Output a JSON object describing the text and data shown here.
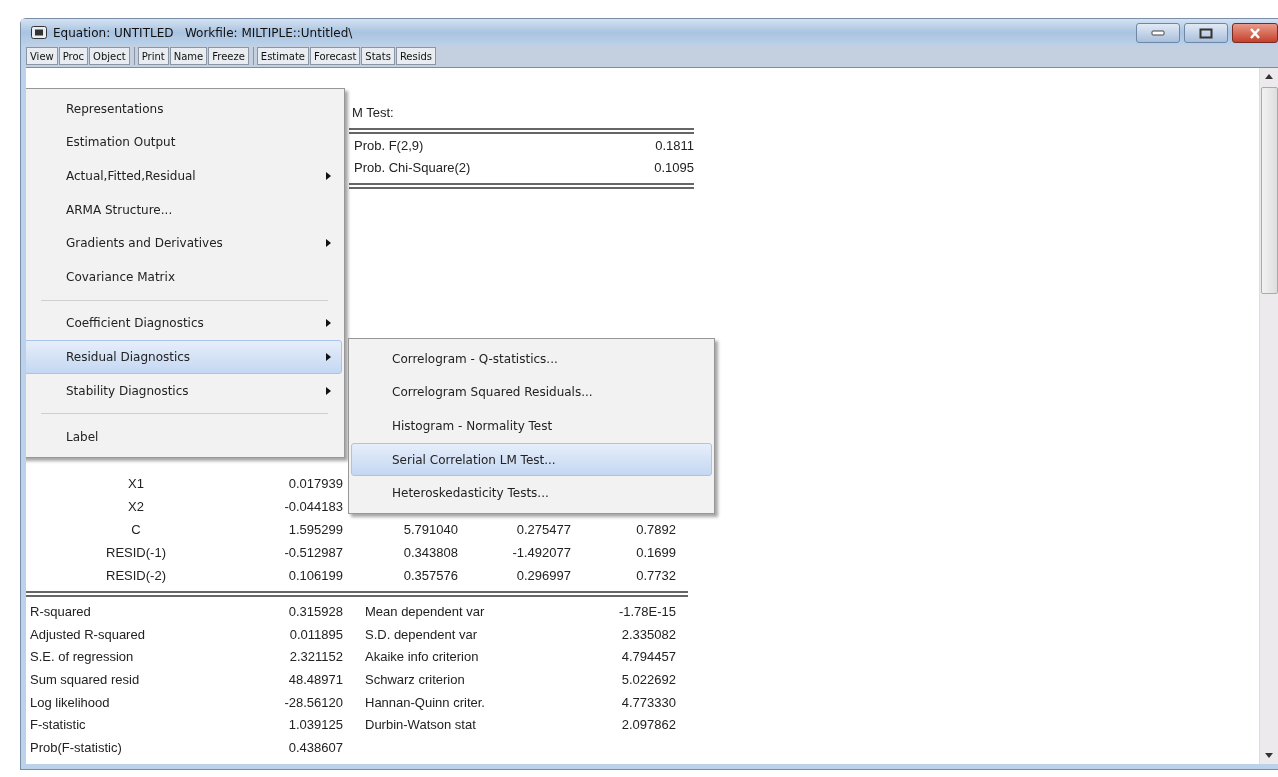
{
  "window": {
    "title": "Equation: UNTITLED   Workfile: MILTIPLE::Untitled\\"
  },
  "toolbar_groups": [
    {
      "buttons": [
        "View",
        "Proc",
        "Object"
      ]
    },
    {
      "buttons": [
        "Print",
        "Name",
        "Freeze"
      ]
    },
    {
      "buttons": [
        "Estimate",
        "Forecast",
        "Stats",
        "Resids"
      ]
    }
  ],
  "output": {
    "header_text": "M Test:",
    "test_stats": [
      {
        "label": "Prob. F(2,9)",
        "value": "0.1811"
      },
      {
        "label": "Prob. Chi-Square(2)",
        "value": "0.1095"
      }
    ],
    "coefficients": [
      {
        "variable": "X1",
        "values": [
          "0.017939"
        ]
      },
      {
        "variable": "X2",
        "values": [
          "-0.044183"
        ]
      },
      {
        "variable": "C",
        "values": [
          "1.595299",
          "5.791040",
          "0.275477",
          "0.7892"
        ]
      },
      {
        "variable": "RESID(-1)",
        "values": [
          "-0.512987",
          "0.343808",
          "-1.492077",
          "0.1699"
        ]
      },
      {
        "variable": "RESID(-2)",
        "values": [
          "0.106199",
          "0.357576",
          "0.296997",
          "0.7732"
        ]
      }
    ],
    "stats": [
      {
        "label": "R-squared",
        "value": "0.315928",
        "label_2": "Mean dependent var",
        "value_2": "-1.78E-15"
      },
      {
        "label": "Adjusted R-squared",
        "value": "0.011895",
        "label_2": "S.D. dependent var",
        "value_2": "2.335082"
      },
      {
        "label": "S.E. of regression",
        "value": "2.321152",
        "label_2": "Akaike info criterion",
        "value_2": "4.794457"
      },
      {
        "label": "Sum squared resid",
        "value": "48.48971",
        "label_2": "Schwarz criterion",
        "value_2": "5.022692"
      },
      {
        "label": "Log likelihood",
        "value": "-28.56120",
        "label_2": "Hannan-Quinn criter.",
        "value_2": "4.773330"
      },
      {
        "label": "F-statistic",
        "value": "1.039125",
        "label_2": "Durbin-Watson stat",
        "value_2": "2.097862"
      },
      {
        "label": "Prob(F-statistic)",
        "value": "0.438607"
      }
    ]
  },
  "menu": [
    {
      "kind": "item",
      "label": "Representations",
      "has_submenu": false,
      "selected": false
    },
    {
      "kind": "item",
      "label": "Estimation Output",
      "has_submenu": false,
      "selected": false
    },
    {
      "kind": "item",
      "label": "Actual,Fitted,Residual",
      "has_submenu": true,
      "selected": false
    },
    {
      "kind": "item",
      "label": "ARMA Structure...",
      "has_submenu": false,
      "selected": false
    },
    {
      "kind": "item",
      "label": "Gradients and Derivatives",
      "has_submenu": true,
      "selected": false
    },
    {
      "kind": "item",
      "label": "Covariance Matrix",
      "has_submenu": false,
      "selected": false
    },
    {
      "kind": "separator"
    },
    {
      "kind": "item",
      "label": "Coefficient Diagnostics",
      "has_submenu": true,
      "selected": false
    },
    {
      "kind": "item",
      "label": "Residual Diagnostics",
      "has_submenu": true,
      "selected": true
    },
    {
      "kind": "item",
      "label": "Stability Diagnostics",
      "has_submenu": true,
      "selected": false
    },
    {
      "kind": "separator"
    },
    {
      "kind": "item",
      "label": "Label",
      "has_submenu": false,
      "selected": false
    }
  ],
  "submenu": [
    {
      "label": "Correlogram - Q-statistics...",
      "selected": false
    },
    {
      "label": "Correlogram Squared Residuals...",
      "selected": false
    },
    {
      "label": "Histogram - Normality Test",
      "selected": false
    },
    {
      "label": "Serial Correlation LM Test...",
      "selected": true
    },
    {
      "label": "Heteroskedasticity Tests...",
      "selected": false
    }
  ]
}
